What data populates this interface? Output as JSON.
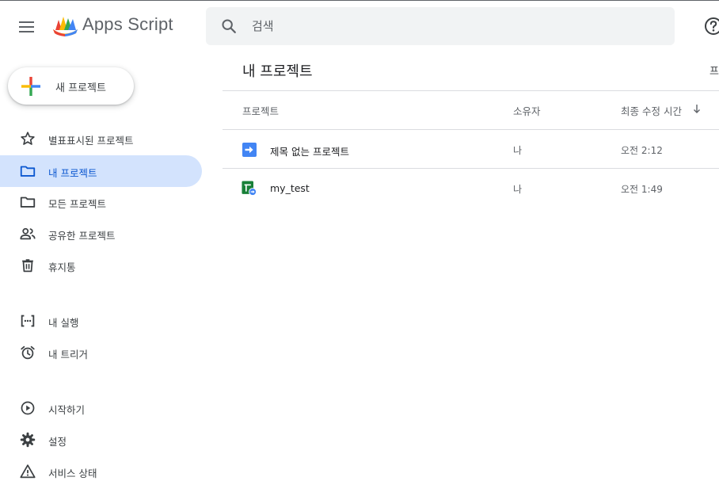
{
  "header": {
    "product_name": "Apps Script",
    "search_placeholder": "검색"
  },
  "sidebar": {
    "new_project_label": "새 프로젝트",
    "items": [
      {
        "label": "별표표시된 프로젝트",
        "icon": "star-icon",
        "active": false
      },
      {
        "label": "내 프로젝트",
        "icon": "folder-icon",
        "active": true
      },
      {
        "label": "모든 프로젝트",
        "icon": "folder-icon",
        "active": false
      },
      {
        "label": "공유한 프로젝트",
        "icon": "people-icon",
        "active": false
      },
      {
        "label": "휴지통",
        "icon": "trash-icon",
        "active": false
      },
      {
        "label": "내 실행",
        "icon": "executions-icon",
        "active": false
      },
      {
        "label": "내 트리거",
        "icon": "alarm-clock-icon",
        "active": false
      },
      {
        "label": "시작하기",
        "icon": "play-circle-icon",
        "active": false
      },
      {
        "label": "설정",
        "icon": "gear-icon",
        "active": false
      },
      {
        "label": "서비스 상태",
        "icon": "warning-icon",
        "active": false
      }
    ]
  },
  "main": {
    "title": "내 프로젝트",
    "title_right_cut": "프",
    "columns": {
      "project": "프로젝트",
      "owner": "소유자",
      "modified": "최종 수정 시간"
    },
    "rows": [
      {
        "name": "제목 없는 프로젝트",
        "owner": "나",
        "modified": "오전 2:12",
        "icon": "standalone-script-icon"
      },
      {
        "name": "my_test",
        "owner": "나",
        "modified": "오전 1:49",
        "icon": "sheets-bound-script-icon"
      }
    ]
  },
  "colors": {
    "active_nav_bg": "#d3e3fd",
    "active_nav_text": "#0b57d0",
    "search_bg": "#f1f3f4",
    "script_blue": "#4285f4",
    "sheets_green": "#188038"
  }
}
